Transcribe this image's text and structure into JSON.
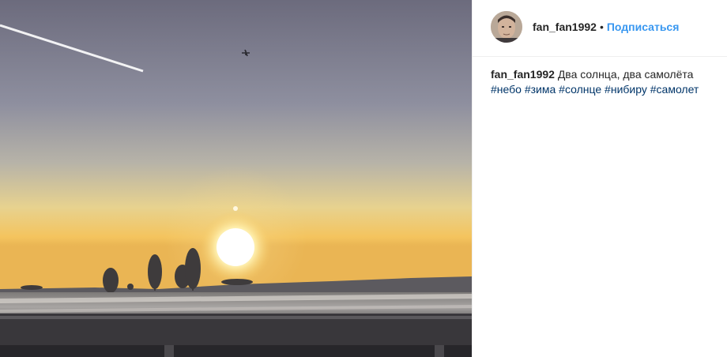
{
  "post": {
    "username": "fan_fan1992",
    "separator": "•",
    "follow_label": "Подписаться",
    "caption": {
      "username": "fan_fan1992",
      "text": "Два солнца, два самолёта",
      "hashtags": [
        "#небо",
        "#зима",
        "#солнце",
        "#нибиру",
        "#самолет"
      ]
    }
  },
  "colors": {
    "link_blue": "#3897f0",
    "hashtag": "#003569",
    "text": "#262626",
    "sky_top": "#6c6b7d",
    "horizon_glow": "#f4c45e"
  },
  "image": {
    "icon": "photo-sunset-two-suns"
  }
}
